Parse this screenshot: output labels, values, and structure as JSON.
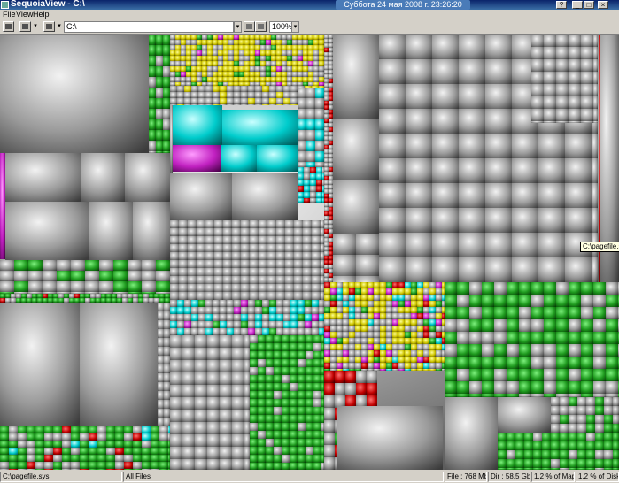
{
  "window": {
    "title": "SequoiaView - C:\\"
  },
  "taskbar_clock": {
    "text": "Суббота 24 мая 2008 г. 23:26:20"
  },
  "title_buttons": {
    "help": "?",
    "minimize": "_",
    "maximize": "□",
    "close": "×"
  },
  "menu": {
    "items": [
      "File",
      "View",
      "Help"
    ]
  },
  "toolbar": {
    "path_value": "C:\\",
    "zoom_value": "100%",
    "dropdown_glyph": "▾"
  },
  "tooltip": {
    "text": "C:\\pagefile.sys"
  },
  "status": {
    "path": "C:\\pagefile.sys",
    "filter": "All Files",
    "file_size": "File : 768 Mb",
    "dir_size": "Dir : 58,5 Gb",
    "map_pct": "1,2 % of Map",
    "disk_pct": "1,2 % of Disk"
  },
  "colors": {
    "title_bar": "#0a246a",
    "window_face": "#d4d0c8",
    "tooltip_bg": "#ffffe1",
    "file_gray": "#a0a0a0",
    "file_green": "#22a022",
    "file_cyan": "#00d8d8",
    "file_yellow": "#d8d000",
    "file_magenta": "#c020c0",
    "file_red": "#c00000"
  },
  "icons": [
    "app-icon",
    "cushion-icon",
    "view-icon",
    "folder-icon",
    "up-folder-icon"
  ]
}
